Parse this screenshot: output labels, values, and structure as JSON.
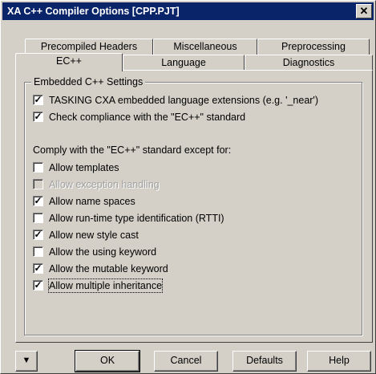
{
  "window": {
    "title": "XA C++ Compiler Options [CPP.PJT]",
    "close_glyph": "✕"
  },
  "tabs": {
    "back_row": [
      "Precompiled Headers",
      "Miscellaneous",
      "Preprocessing"
    ],
    "front_row": [
      "EC++",
      "Language",
      "Diagnostics"
    ],
    "active": "EC++"
  },
  "group": {
    "label": "Embedded C++ Settings",
    "top_options": [
      {
        "label": "TASKING CXA embedded language extensions (e.g. '_near')",
        "checked": true,
        "enabled": true
      },
      {
        "label": "Check compliance with the \"EC++\" standard",
        "checked": true,
        "enabled": true
      }
    ],
    "comply_text": "Comply with the \"EC++\" standard except for:",
    "exceptions": [
      {
        "label": "Allow templates",
        "checked": false,
        "enabled": true
      },
      {
        "label": "Allow exception handling",
        "checked": false,
        "enabled": false
      },
      {
        "label": "Allow name spaces",
        "checked": true,
        "enabled": true
      },
      {
        "label": "Allow run-time type identification (RTTI)",
        "checked": false,
        "enabled": true
      },
      {
        "label": "Allow new style cast",
        "checked": true,
        "enabled": true
      },
      {
        "label": "Allow the using keyword",
        "checked": false,
        "enabled": true
      },
      {
        "label": "Allow the mutable keyword",
        "checked": true,
        "enabled": true
      },
      {
        "label": "Allow multiple inheritance",
        "checked": true,
        "enabled": true
      }
    ]
  },
  "buttons": {
    "menu_arrow": "▼",
    "ok": "OK",
    "cancel": "Cancel",
    "defaults": "Defaults",
    "help": "Help"
  },
  "check_glyph": "✓"
}
